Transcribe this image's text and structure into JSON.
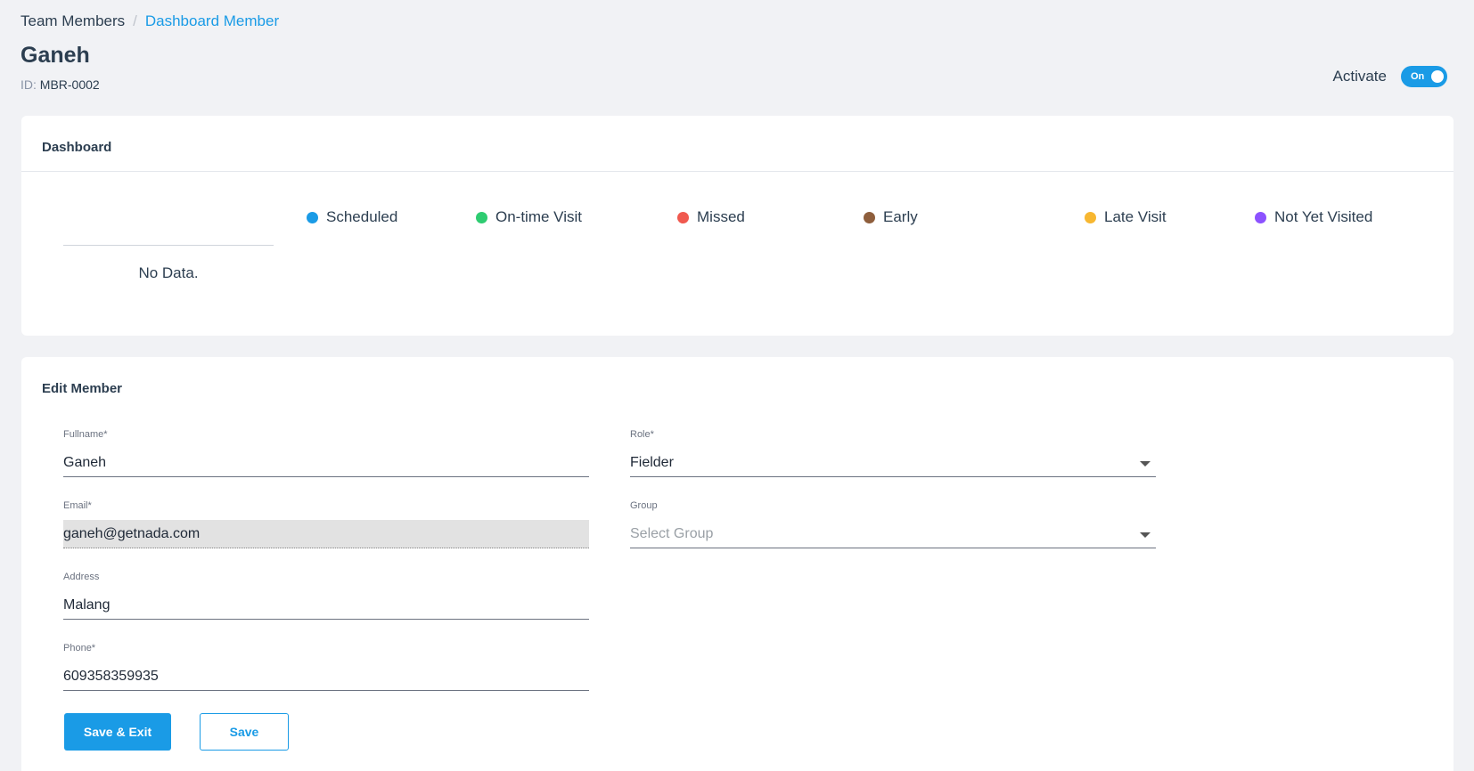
{
  "breadcrumb": {
    "parent": "Team Members",
    "separator": "/",
    "current": "Dashboard Member"
  },
  "member": {
    "name": "Ganeh",
    "id_label": "ID:",
    "id_value": "MBR-0002"
  },
  "activate": {
    "label": "Activate",
    "toggle_text": "On",
    "state": "on"
  },
  "dashboard": {
    "title": "Dashboard",
    "no_data": "No Data.",
    "legend": [
      {
        "label": "Scheduled",
        "color": "#1a9be6"
      },
      {
        "label": "On-time Visit",
        "color": "#2ecc71"
      },
      {
        "label": "Missed",
        "color": "#f0594f"
      },
      {
        "label": "Early",
        "color": "#8e5e3c"
      },
      {
        "label": "Late Visit",
        "color": "#f7b731"
      },
      {
        "label": "Not Yet Visited",
        "color": "#8c52ff"
      }
    ]
  },
  "edit": {
    "title": "Edit Member",
    "fullname": {
      "label": "Fullname*",
      "value": "Ganeh"
    },
    "email": {
      "label": "Email*",
      "value": "ganeh@getnada.com"
    },
    "address": {
      "label": "Address",
      "value": "Malang"
    },
    "phone": {
      "label": "Phone*",
      "value": "609358359935"
    },
    "role": {
      "label": "Role*",
      "value": "Fielder"
    },
    "group": {
      "label": "Group",
      "placeholder": "Select Group"
    },
    "save_exit_label": "Save & Exit",
    "save_label": "Save"
  },
  "colors": {
    "accent": "#1a9be6",
    "background": "#f1f2f5"
  }
}
